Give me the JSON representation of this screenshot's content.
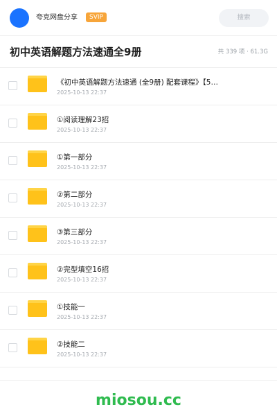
{
  "header": {
    "sharer_name": "夸克网盘分享",
    "badge": "SVIP",
    "search_placeholder": "搜索"
  },
  "folder": {
    "title": "初中英语解题方法速通全9册",
    "stats": "共 339 项 · 61.3G"
  },
  "files": [
    {
      "name": "《初中英语解题方法速通 (全9册) 配套课程》【5…",
      "date": "2025-10-13 22:37"
    },
    {
      "name": "①阅读理解23招",
      "date": "2025-10-13 22:37"
    },
    {
      "name": "①第一部分",
      "date": "2025-10-13 22:37"
    },
    {
      "name": "②第二部分",
      "date": "2025-10-13 22:37"
    },
    {
      "name": "③第三部分",
      "date": "2025-10-13 22:37"
    },
    {
      "name": "②完型填空16招",
      "date": "2025-10-13 22:37"
    },
    {
      "name": "①技能一",
      "date": "2025-10-13 22:37"
    },
    {
      "name": "②技能二",
      "date": "2025-10-13 22:37"
    }
  ],
  "watermark": "miosou.cc",
  "colors": {
    "avatar": "#1a73ff",
    "badge": "#f7a53a",
    "folder_icon": "#ffc21a",
    "watermark": "#2fbb4f"
  }
}
